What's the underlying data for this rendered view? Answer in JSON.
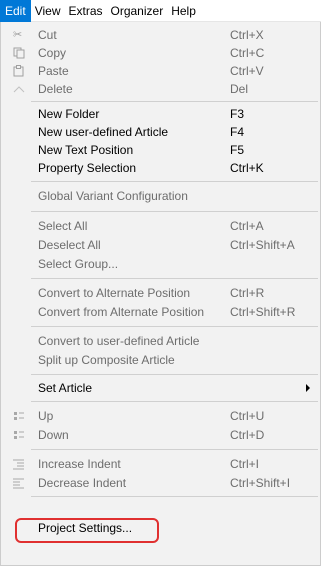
{
  "menubar": {
    "items": [
      "Edit",
      "View",
      "Extras",
      "Organizer",
      "Help"
    ]
  },
  "menu": {
    "cut": {
      "label": "Cut",
      "shortcut": "Ctrl+X",
      "icon": "scissors-icon"
    },
    "copy": {
      "label": "Copy",
      "shortcut": "Ctrl+C",
      "icon": "copy-icon"
    },
    "paste": {
      "label": "Paste",
      "shortcut": "Ctrl+V",
      "icon": "paste-icon"
    },
    "delete": {
      "label": "Delete",
      "shortcut": "Del",
      "icon": "delete-icon"
    },
    "new_folder": {
      "label": "New Folder",
      "shortcut": "F3"
    },
    "new_user_article": {
      "label": "New user-defined Article",
      "shortcut": "F4"
    },
    "new_text_position": {
      "label": "New Text Position",
      "shortcut": "F5"
    },
    "property_selection": {
      "label": "Property Selection",
      "shortcut": "Ctrl+K"
    },
    "global_variant": {
      "label": "Global Variant Configuration"
    },
    "select_all": {
      "label": "Select All",
      "shortcut": "Ctrl+A"
    },
    "deselect_all": {
      "label": "Deselect All",
      "shortcut": "Ctrl+Shift+A"
    },
    "select_group": {
      "label": "Select Group..."
    },
    "convert_to_alt": {
      "label": "Convert to Alternate Position",
      "shortcut": "Ctrl+R"
    },
    "convert_from_alt": {
      "label": "Convert from Alternate Position",
      "shortcut": "Ctrl+Shift+R"
    },
    "convert_to_user": {
      "label": "Convert to user-defined Article"
    },
    "split_composite": {
      "label": "Split up Composite Article"
    },
    "set_article": {
      "label": "Set Article"
    },
    "up": {
      "label": "Up",
      "shortcut": "Ctrl+U",
      "icon": "move-up-icon"
    },
    "down": {
      "label": "Down",
      "shortcut": "Ctrl+D",
      "icon": "move-down-icon"
    },
    "increase_indent": {
      "label": "Increase Indent",
      "shortcut": "Ctrl+I",
      "icon": "increase-indent-icon"
    },
    "decrease_indent": {
      "label": "Decrease Indent",
      "shortcut": "Ctrl+Shift+I",
      "icon": "decrease-indent-icon"
    },
    "project_settings": {
      "label": "Project Settings..."
    }
  },
  "colors": {
    "accent": "#0078d7",
    "highlight_border": "#e03030",
    "disabled_text": "#6d6d6d"
  }
}
